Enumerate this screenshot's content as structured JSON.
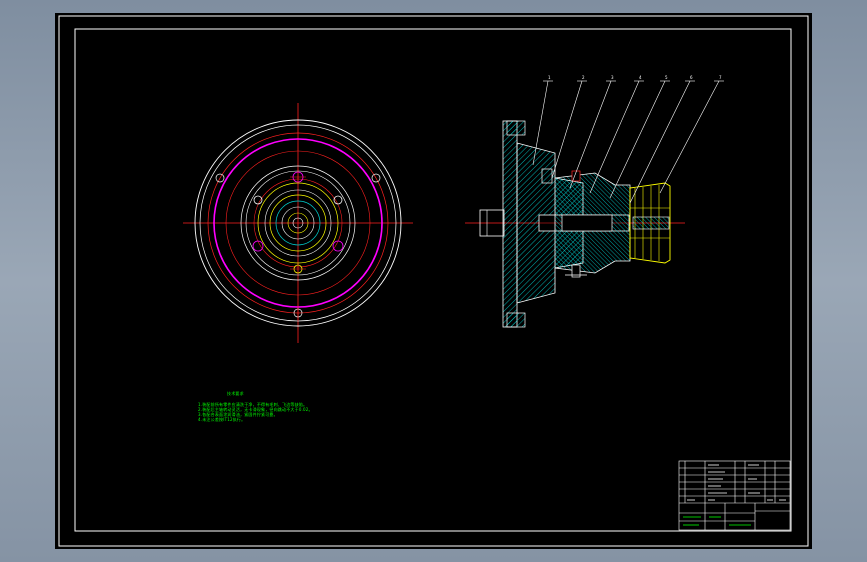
{
  "colors": {
    "frame": "#ffffff",
    "centerline": "#ff2020",
    "outline": "#ffffff",
    "circle_magenta": "#ff00ff",
    "hatch": "#00c8c8",
    "part_yellow": "#ffff00",
    "note_text": "#00ff00",
    "leader": "#ffffff"
  },
  "balloons": [
    "1",
    "2",
    "3",
    "4",
    "5",
    "6",
    "7"
  ],
  "notes": {
    "title": "技术要求",
    "lines": [
      "1.装配前所有零件应清洗干净，不得有毛刺、飞边等缺陷。",
      "2.装配后主轴转动灵活，无卡滞现象，径向跳动不大于0.02。",
      "3.各配合表面涂润滑油，紧固件拧紧可靠。",
      "4.未注公差按IT12执行。"
    ]
  }
}
